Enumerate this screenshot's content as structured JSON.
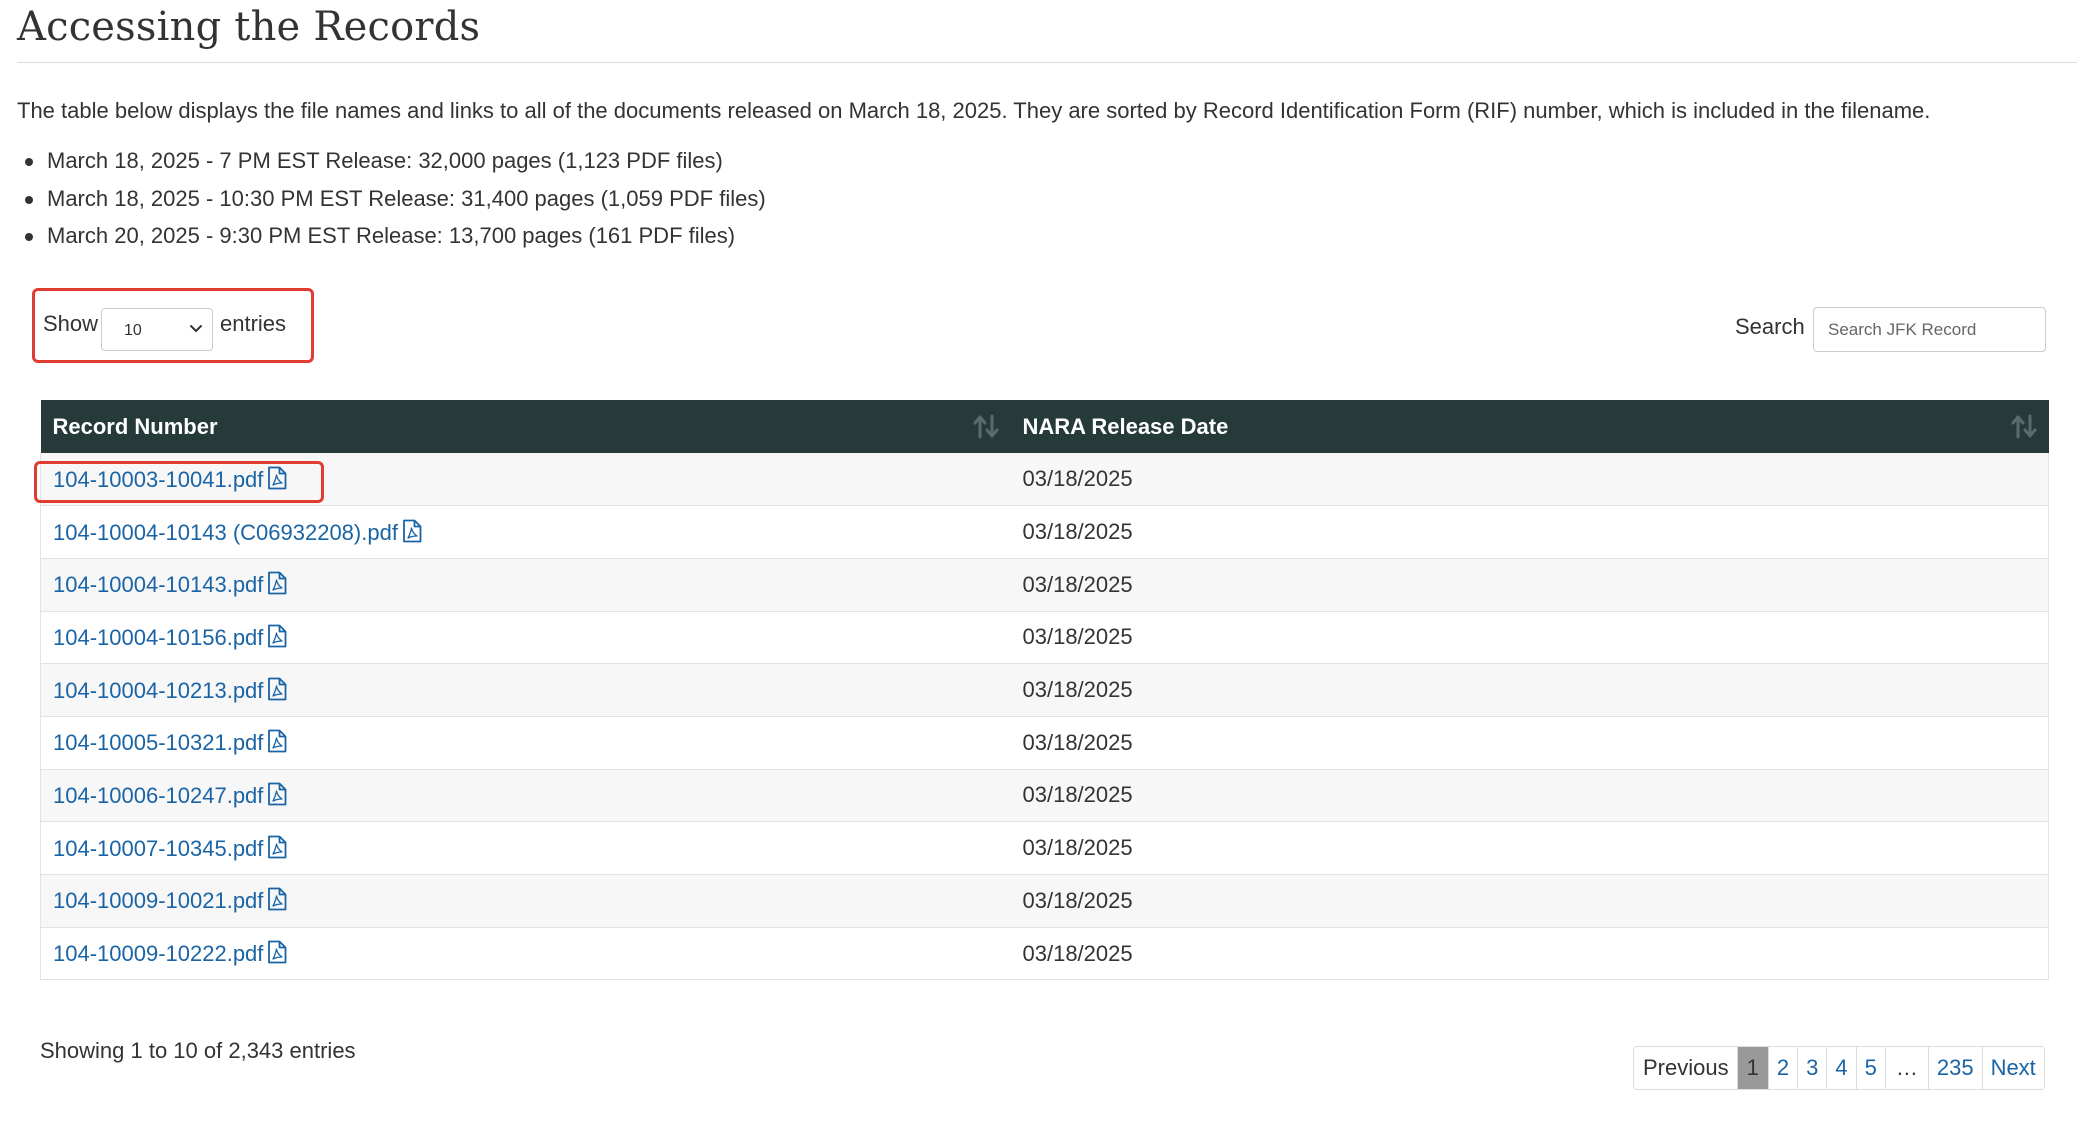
{
  "header": {
    "title": "Accessing the Records"
  },
  "intro": {
    "text": "The table below displays the file names and links to all of the documents released on March 18, 2025.  They are sorted by Record Identification Form (RIF) number, which is included in the filename."
  },
  "releases": [
    "March 18, 2025 - 7 PM EST Release: 32,000 pages (1,123 PDF files)",
    "March 18, 2025 - 10:30 PM EST Release: 31,400 pages (1,059 PDF files)",
    "March 20, 2025 - 9:30 PM EST Release: 13,700 pages (161 PDF files)"
  ],
  "controls": {
    "show_label": "Show",
    "entries_value": "10",
    "entries_label": "entries",
    "search_label": "Search",
    "search_placeholder": "Search JFK Record"
  },
  "table": {
    "columns": [
      "Record Number",
      "NARA Release Date"
    ],
    "rows": [
      {
        "record": "104-10003-10041.pdf",
        "date": "03/18/2025"
      },
      {
        "record": "104-10004-10143 (C06932208).pdf",
        "date": "03/18/2025"
      },
      {
        "record": "104-10004-10143.pdf",
        "date": "03/18/2025"
      },
      {
        "record": "104-10004-10156.pdf",
        "date": "03/18/2025"
      },
      {
        "record": "104-10004-10213.pdf",
        "date": "03/18/2025"
      },
      {
        "record": "104-10005-10321.pdf",
        "date": "03/18/2025"
      },
      {
        "record": "104-10006-10247.pdf",
        "date": "03/18/2025"
      },
      {
        "record": "104-10007-10345.pdf",
        "date": "03/18/2025"
      },
      {
        "record": "104-10009-10021.pdf",
        "date": "03/18/2025"
      },
      {
        "record": "104-10009-10222.pdf",
        "date": "03/18/2025"
      }
    ]
  },
  "footer": {
    "info": "Showing 1 to 10 of 2,343 entries",
    "pagination": {
      "previous": "Previous",
      "pages": [
        "1",
        "2",
        "3",
        "4",
        "5"
      ],
      "ellipsis": "…",
      "last": "235",
      "next": "Next",
      "current": "1"
    }
  },
  "colors": {
    "header_bg": "#263a3a",
    "link": "#1a64a6",
    "highlight": "#e03c31",
    "current_page_bg": "#999999"
  },
  "icons": {
    "sort": "sort-icon",
    "file": "pdf-file-icon",
    "dropdown": "chevron-down-icon"
  }
}
